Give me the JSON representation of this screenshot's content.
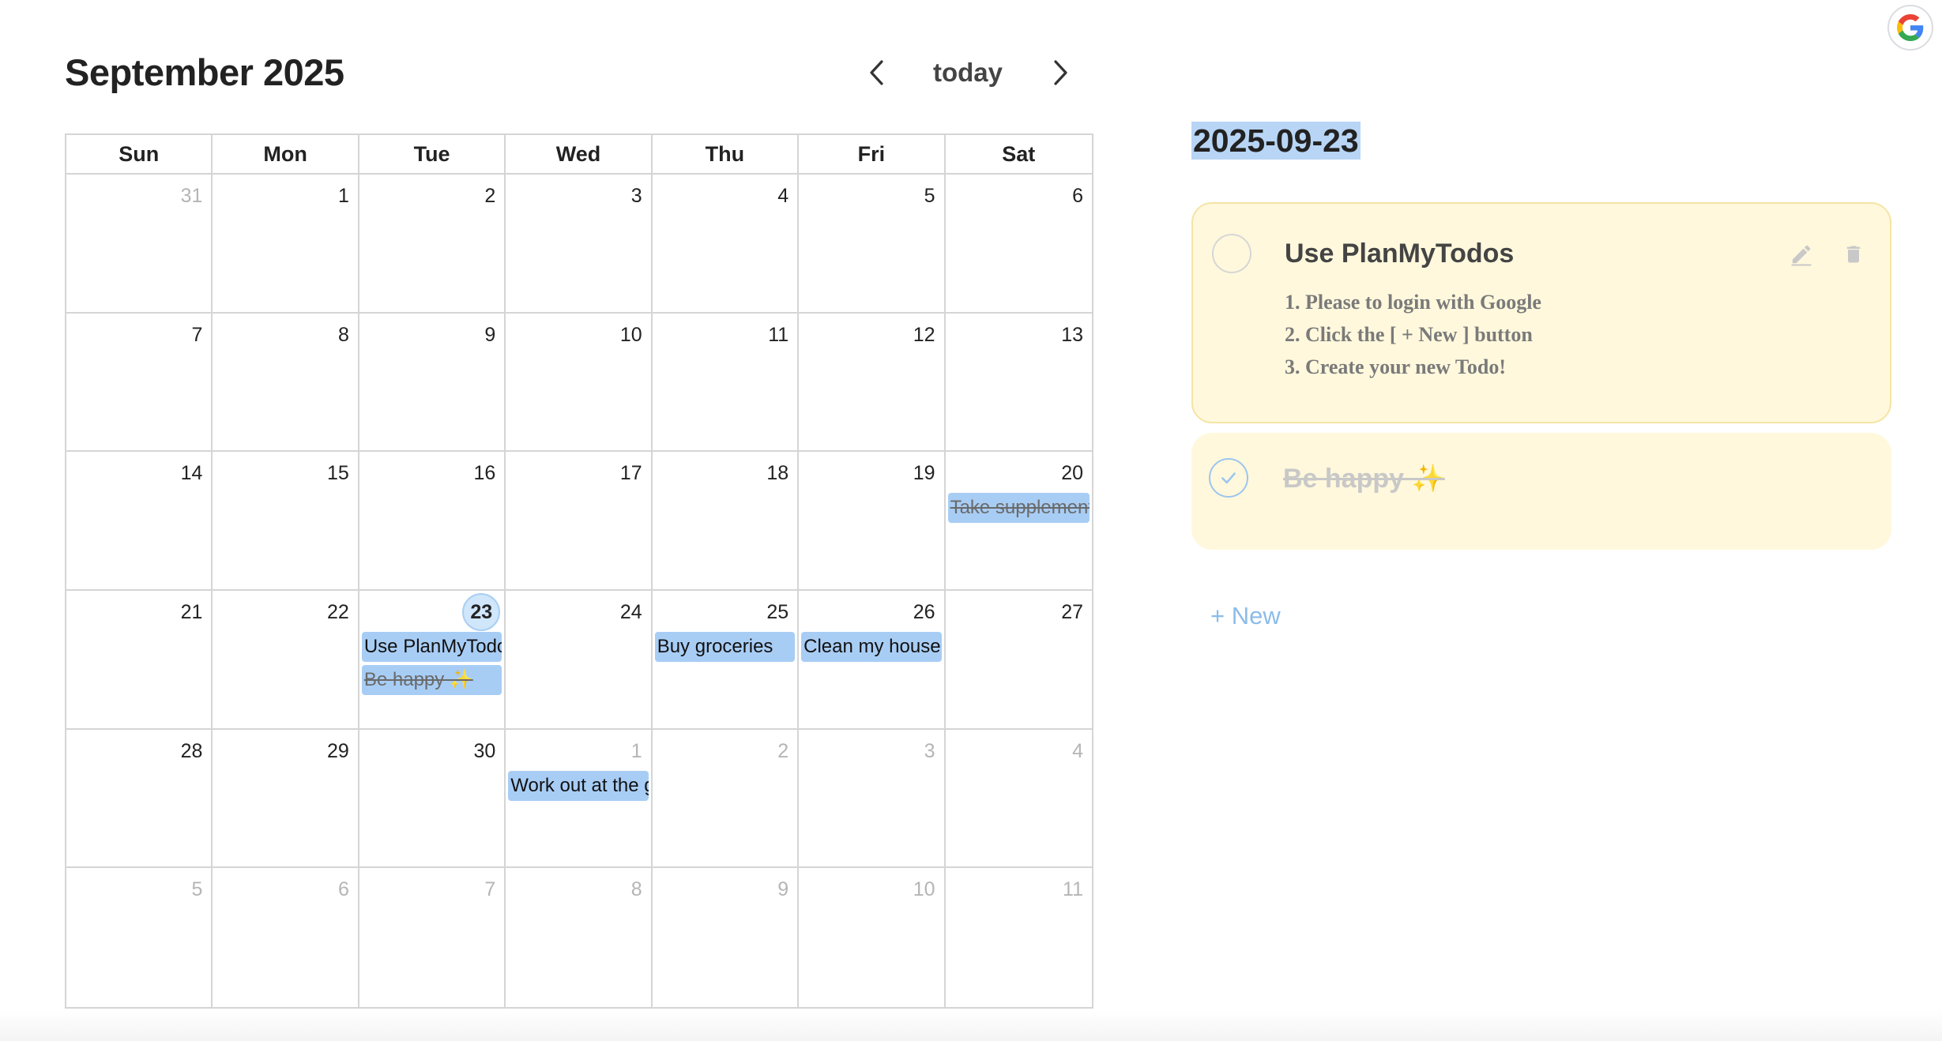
{
  "header": {
    "title": "September 2025",
    "today_label": "today"
  },
  "calendar": {
    "weekdays": [
      "Sun",
      "Mon",
      "Tue",
      "Wed",
      "Thu",
      "Fri",
      "Sat"
    ],
    "weeks": [
      [
        {
          "day": "31",
          "other": true,
          "events": []
        },
        {
          "day": "1",
          "events": []
        },
        {
          "day": "2",
          "events": []
        },
        {
          "day": "3",
          "events": []
        },
        {
          "day": "4",
          "events": []
        },
        {
          "day": "5",
          "events": []
        },
        {
          "day": "6",
          "events": []
        }
      ],
      [
        {
          "day": "7",
          "events": []
        },
        {
          "day": "8",
          "events": []
        },
        {
          "day": "9",
          "events": []
        },
        {
          "day": "10",
          "events": []
        },
        {
          "day": "11",
          "events": []
        },
        {
          "day": "12",
          "events": []
        },
        {
          "day": "13",
          "events": []
        }
      ],
      [
        {
          "day": "14",
          "events": []
        },
        {
          "day": "15",
          "events": []
        },
        {
          "day": "16",
          "events": []
        },
        {
          "day": "17",
          "events": []
        },
        {
          "day": "18",
          "events": []
        },
        {
          "day": "19",
          "events": []
        },
        {
          "day": "20",
          "events": [
            {
              "title": "Take supplements",
              "done": true
            }
          ]
        }
      ],
      [
        {
          "day": "21",
          "events": []
        },
        {
          "day": "22",
          "events": []
        },
        {
          "day": "23",
          "today": true,
          "events": [
            {
              "title": "Use PlanMyTodos",
              "done": false
            },
            {
              "title": "Be happy ✨",
              "done": true
            }
          ]
        },
        {
          "day": "24",
          "events": []
        },
        {
          "day": "25",
          "events": [
            {
              "title": "Buy groceries",
              "done": false
            }
          ]
        },
        {
          "day": "26",
          "events": [
            {
              "title": "Clean my house",
              "done": false
            }
          ]
        },
        {
          "day": "27",
          "events": []
        }
      ],
      [
        {
          "day": "28",
          "events": []
        },
        {
          "day": "29",
          "events": []
        },
        {
          "day": "30",
          "events": []
        },
        {
          "day": "1",
          "other": true,
          "events": [
            {
              "title": "Work out at the gym",
              "done": false
            }
          ]
        },
        {
          "day": "2",
          "other": true,
          "events": []
        },
        {
          "day": "3",
          "other": true,
          "events": []
        },
        {
          "day": "4",
          "other": true,
          "events": []
        }
      ],
      [
        {
          "day": "5",
          "other": true,
          "events": []
        },
        {
          "day": "6",
          "other": true,
          "events": []
        },
        {
          "day": "7",
          "other": true,
          "events": []
        },
        {
          "day": "8",
          "other": true,
          "events": []
        },
        {
          "day": "9",
          "other": true,
          "events": []
        },
        {
          "day": "10",
          "other": true,
          "events": []
        },
        {
          "day": "11",
          "other": true,
          "events": []
        }
      ]
    ]
  },
  "panel": {
    "selected_date": "2025-09-23",
    "todos": [
      {
        "title": "Use PlanMyTodos",
        "lines": [
          "1. Please to login with Google",
          "2. Click the [ + New ] button",
          "3. Create your new Todo!"
        ],
        "done": false
      },
      {
        "title": "Be happy ✨",
        "done": true
      }
    ],
    "new_label": "+ New"
  },
  "colors": {
    "event_bg": "#a8cdf5",
    "today_circle": "#cfe6fb",
    "card_bg": "#fff8dc",
    "new_button": "#8cbce8"
  },
  "icons": {
    "google": "google-g-icon",
    "prev": "chevron-left-icon",
    "next": "chevron-right-icon",
    "edit": "pencil-icon",
    "delete": "trash-icon",
    "check": "check-icon"
  }
}
